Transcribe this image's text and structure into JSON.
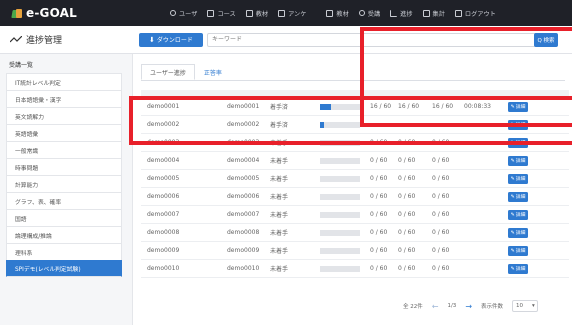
{
  "app": {
    "logo_text": "e-GOAL"
  },
  "topnav": [
    {
      "label": "ユーザ",
      "icon": "person-icon"
    },
    {
      "label": "コース",
      "icon": "grid-icon"
    },
    {
      "label": "教材",
      "icon": "book-icon"
    },
    {
      "label": "アンケ",
      "icon": "survey-icon"
    },
    {
      "label": "教材",
      "icon": "book-icon"
    },
    {
      "label": "受講",
      "icon": "play-icon"
    },
    {
      "label": "進捗",
      "icon": "trend-icon"
    },
    {
      "label": "集計",
      "icon": "chart-icon"
    },
    {
      "label": "ログアウト",
      "icon": "logout-icon"
    }
  ],
  "header": {
    "title": "進捗管理",
    "download_label": "ダウンロード",
    "search_placeholder": "キーワード",
    "search_button": "Q 検索"
  },
  "sidebar": {
    "title": "受講一覧",
    "items": [
      "IT統計レベル判定",
      "日本語語彙・漢字",
      "英文読解力",
      "英語語彙",
      "一般常識",
      "時事問題",
      "計算能力",
      "グラフ、表、確率",
      "国語",
      "論理構成/推論",
      "理科系",
      "SPIデモ(レベル判定試験)"
    ],
    "active_index": 11
  },
  "tabs": [
    {
      "label": "ユーザー進捗",
      "active": true
    },
    {
      "label": "正答率",
      "active": false
    }
  ],
  "table": {
    "rows": [
      {
        "id": "demo0001",
        "name": "demo0001",
        "status": "着手済",
        "progress": 0.27,
        "p1": "16 / 60",
        "p2": "16 / 60",
        "p3": "16 / 60",
        "time": "00:08:33"
      },
      {
        "id": "demo0002",
        "name": "demo0002",
        "status": "着手済",
        "progress": 0.1,
        "p1": "",
        "p2": "",
        "p3": "",
        "time": ""
      },
      {
        "id": "demo0003",
        "name": "demo0003",
        "status": "未着手",
        "progress": 0,
        "p1": "0 / 60",
        "p2": "0 / 60",
        "p3": "0 / 60",
        "time": ""
      },
      {
        "id": "demo0004",
        "name": "demo0004",
        "status": "未着手",
        "progress": 0,
        "p1": "0 / 60",
        "p2": "0 / 60",
        "p3": "0 / 60",
        "time": ""
      },
      {
        "id": "demo0005",
        "name": "demo0005",
        "status": "未着手",
        "progress": 0,
        "p1": "0 / 60",
        "p2": "0 / 60",
        "p3": "0 / 60",
        "time": ""
      },
      {
        "id": "demo0006",
        "name": "demo0006",
        "status": "未着手",
        "progress": 0,
        "p1": "0 / 60",
        "p2": "0 / 60",
        "p3": "0 / 60",
        "time": ""
      },
      {
        "id": "demo0007",
        "name": "demo0007",
        "status": "未着手",
        "progress": 0,
        "p1": "0 / 60",
        "p2": "0 / 60",
        "p3": "0 / 60",
        "time": ""
      },
      {
        "id": "demo0008",
        "name": "demo0008",
        "status": "未着手",
        "progress": 0,
        "p1": "0 / 60",
        "p2": "0 / 60",
        "p3": "0 / 60",
        "time": ""
      },
      {
        "id": "demo0009",
        "name": "demo0009",
        "status": "未着手",
        "progress": 0,
        "p1": "0 / 60",
        "p2": "0 / 60",
        "p3": "0 / 60",
        "time": ""
      },
      {
        "id": "demo0010",
        "name": "demo0010",
        "status": "未着手",
        "progress": 0,
        "p1": "0 / 60",
        "p2": "0 / 60",
        "p3": "0 / 60",
        "time": ""
      }
    ],
    "detail_label": "詳細"
  },
  "pager": {
    "total": "全 22件",
    "page": "1/3",
    "per_page_label": "表示件数",
    "per_page_value": "10"
  },
  "colors": {
    "accent": "#2f7ad0",
    "annotation": "#e8202a",
    "topbar": "#1f2128"
  }
}
